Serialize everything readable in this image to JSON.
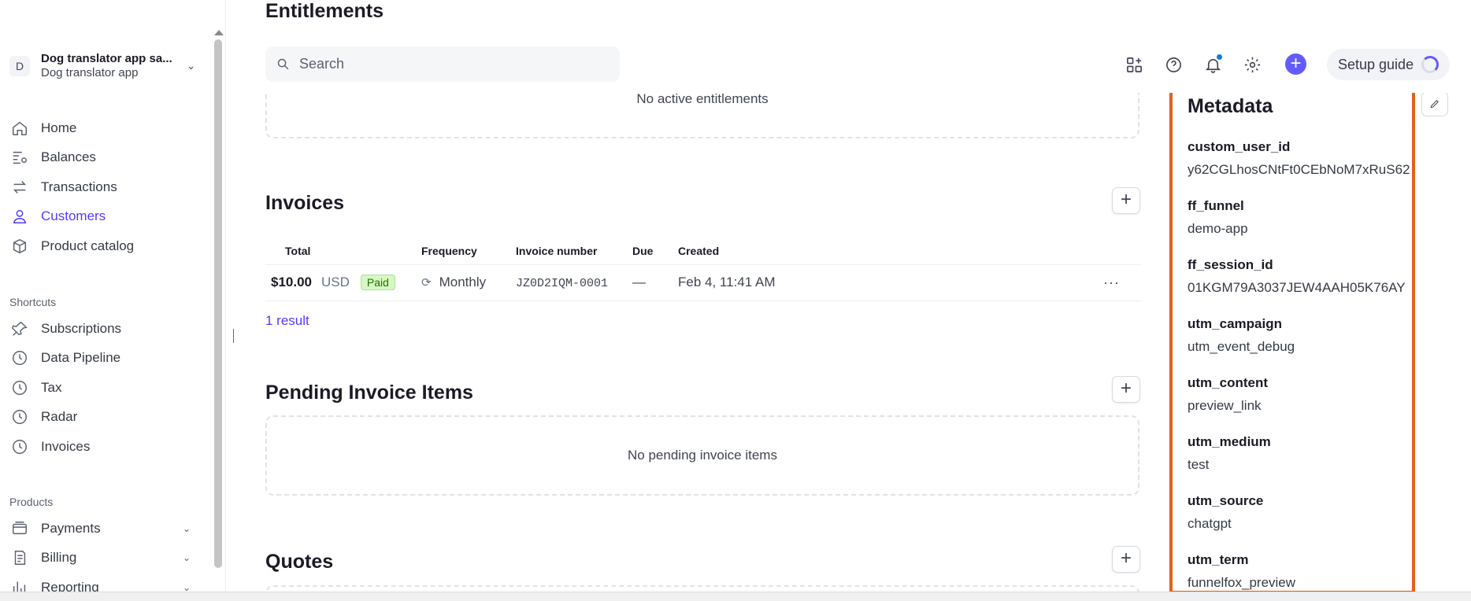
{
  "account": {
    "initial": "D",
    "name": "Dog translator app sa...",
    "sub": "Dog translator app"
  },
  "nav": {
    "main": [
      {
        "label": "Home",
        "icon": "home-icon"
      },
      {
        "label": "Balances",
        "icon": "balances-icon"
      },
      {
        "label": "Transactions",
        "icon": "transactions-icon"
      },
      {
        "label": "Customers",
        "icon": "customers-icon",
        "active": true
      },
      {
        "label": "Product catalog",
        "icon": "product-catalog-icon"
      }
    ],
    "shortcuts_title": "Shortcuts",
    "shortcuts": [
      {
        "label": "Subscriptions",
        "icon": "pin-icon"
      },
      {
        "label": "Data Pipeline",
        "icon": "clock-icon"
      },
      {
        "label": "Tax",
        "icon": "clock-icon"
      },
      {
        "label": "Radar",
        "icon": "clock-icon"
      },
      {
        "label": "Invoices",
        "icon": "clock-icon"
      }
    ],
    "products_title": "Products",
    "products": [
      {
        "label": "Payments",
        "icon": "payments-icon"
      },
      {
        "label": "Billing",
        "icon": "billing-icon"
      },
      {
        "label": "Reporting",
        "icon": "reporting-icon"
      }
    ]
  },
  "topbar": {
    "search_placeholder": "Search",
    "setup_guide": "Setup guide",
    "plus": "+"
  },
  "main": {
    "entitlements_title": "Entitlements",
    "entitlements_empty": "No active entitlements",
    "invoices_title": "Invoices",
    "invoice_columns": [
      "Total",
      "Frequency",
      "Invoice number",
      "Due",
      "Created"
    ],
    "invoice_rows": [
      {
        "amount": "$10.00",
        "currency": "USD",
        "status": "Paid",
        "frequency": "Monthly",
        "number": "JZ0D2IQM-0001",
        "due": "—",
        "created": "Feb 4, 11:41 AM"
      }
    ],
    "invoice_result": "1 result",
    "pending_title": "Pending Invoice Items",
    "pending_empty": "No pending invoice items",
    "quotes_title": "Quotes"
  },
  "metadata": {
    "title": "Metadata",
    "items": [
      {
        "key": "custom_user_id",
        "value": "y62CGLhosCNtFt0CEbNoM7xRuS62"
      },
      {
        "key": "ff_funnel",
        "value": "demo-app"
      },
      {
        "key": "ff_session_id",
        "value": "01KGM79A3037JEW4AAH05K76AY"
      },
      {
        "key": "utm_campaign",
        "value": "utm_event_debug"
      },
      {
        "key": "utm_content",
        "value": "preview_link"
      },
      {
        "key": "utm_medium",
        "value": "test"
      },
      {
        "key": "utm_source",
        "value": "chatgpt"
      },
      {
        "key": "utm_term",
        "value": "funnelfox_preview"
      }
    ]
  },
  "colors": {
    "accent": "#533afd",
    "highlight_border": "#e2621b",
    "paid_badge": "#d7f7c2"
  }
}
